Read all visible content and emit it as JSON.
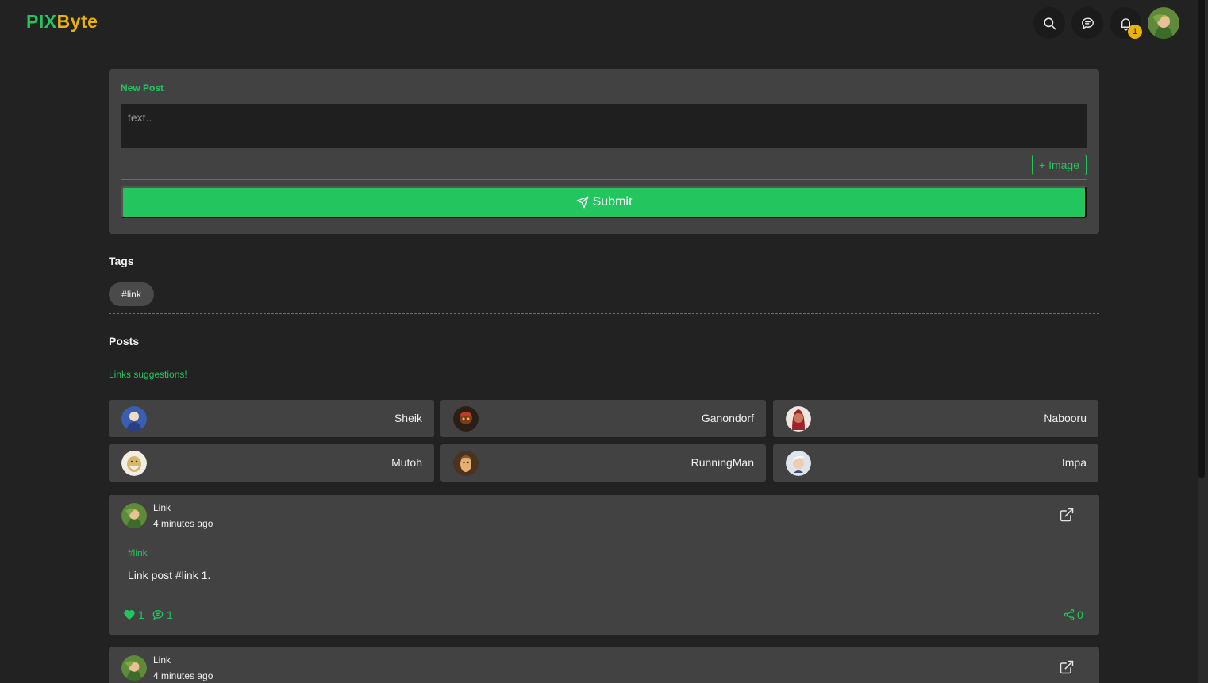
{
  "header": {
    "logo_part1": "PIX",
    "logo_part2": "Byte",
    "notification_count": "1",
    "icons": [
      "search-icon",
      "chat-icon",
      "bell-icon"
    ]
  },
  "new_post": {
    "label": "New Post",
    "placeholder": "text..",
    "image_button": "+ Image",
    "submit_label": "Submit"
  },
  "tags": {
    "title": "Tags",
    "items": [
      "#link"
    ]
  },
  "posts_section": {
    "title": "Posts",
    "suggestions_label": "Links suggestions!",
    "suggestions": [
      {
        "name": "Sheik"
      },
      {
        "name": "Ganondorf"
      },
      {
        "name": "Nabooru"
      },
      {
        "name": "Mutoh"
      },
      {
        "name": "RunningMan"
      },
      {
        "name": "Impa"
      }
    ]
  },
  "posts": [
    {
      "author": "Link",
      "time": "4 minutes ago",
      "tag": "#link",
      "text": "Link post #link 1.",
      "likes": "1",
      "comments": "1",
      "shares": "0"
    },
    {
      "author": "Link",
      "time": "4 minutes ago"
    }
  ],
  "colors": {
    "accent": "#22c55e",
    "logo_secondary": "#eab308",
    "background": "#222222",
    "panel": "#424242"
  }
}
